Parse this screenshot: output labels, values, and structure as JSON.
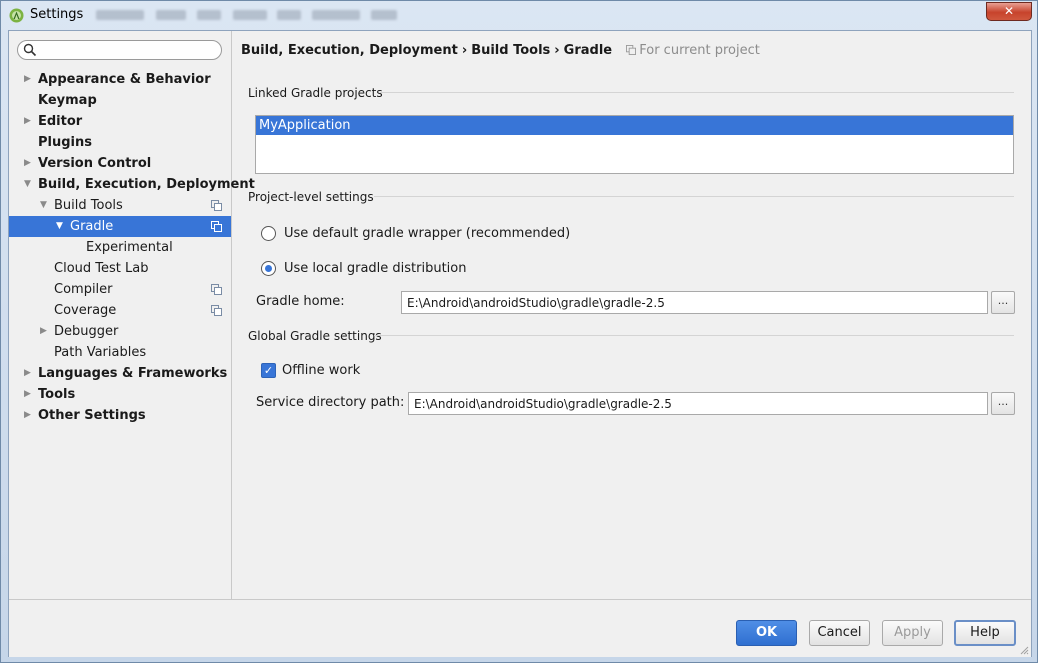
{
  "window": {
    "title": "Settings",
    "close_glyph": "✕",
    "close_color": "#c7432c"
  },
  "sidebar": {
    "search": {
      "value": "",
      "placeholder": ""
    },
    "items": [
      {
        "label": "Appearance & Behavior",
        "bold": true,
        "arrow": "right"
      },
      {
        "label": "Keymap",
        "bold": true
      },
      {
        "label": "Editor",
        "bold": true,
        "arrow": "right"
      },
      {
        "label": "Plugins",
        "bold": true
      },
      {
        "label": "Version Control",
        "bold": true,
        "arrow": "right"
      },
      {
        "label": "Build, Execution, Deployment",
        "bold": true,
        "arrow": "down"
      },
      {
        "label": "Build Tools",
        "arrow": "down",
        "icon": "copy-icon"
      },
      {
        "label": "Gradle",
        "arrow": "down",
        "icon": "copy-icon",
        "selected": true
      },
      {
        "label": "Experimental"
      },
      {
        "label": "Cloud Test Lab"
      },
      {
        "label": "Compiler",
        "icon": "copy-icon"
      },
      {
        "label": "Coverage",
        "icon": "copy-icon"
      },
      {
        "label": "Debugger",
        "arrow": "right"
      },
      {
        "label": "Path Variables"
      },
      {
        "label": "Languages & Frameworks",
        "bold": true,
        "arrow": "right"
      },
      {
        "label": "Tools",
        "bold": true,
        "arrow": "right"
      },
      {
        "label": "Other Settings",
        "bold": true,
        "arrow": "right"
      }
    ]
  },
  "breadcrumb": {
    "parts": [
      "Build, Execution, Deployment",
      "Build Tools",
      "Gradle"
    ],
    "separator": "›",
    "note": "For current project"
  },
  "linked_projects": {
    "title": "Linked Gradle projects",
    "items": [
      "MyApplication"
    ]
  },
  "project_settings": {
    "title": "Project-level settings",
    "option_default": "Use default gradle wrapper (recommended)",
    "option_local": "Use local gradle distribution",
    "selected_option": "local",
    "gradle_home_label": "Gradle home:",
    "gradle_home_value": "E:\\Android\\androidStudio\\gradle\\gradle-2.5",
    "browse_label": "..."
  },
  "global_settings": {
    "title": "Global Gradle settings",
    "offline_label": "Offline work",
    "offline_checked": true,
    "service_dir_label": "Service directory path:",
    "service_dir_value": "E:\\Android\\androidStudio\\gradle\\gradle-2.5",
    "browse_label": "..."
  },
  "footer": {
    "ok": "OK",
    "cancel": "Cancel",
    "apply": "Apply",
    "help": "Help"
  },
  "colors": {
    "selection": "#3875d7",
    "primary_button": "#2f6fd0"
  }
}
